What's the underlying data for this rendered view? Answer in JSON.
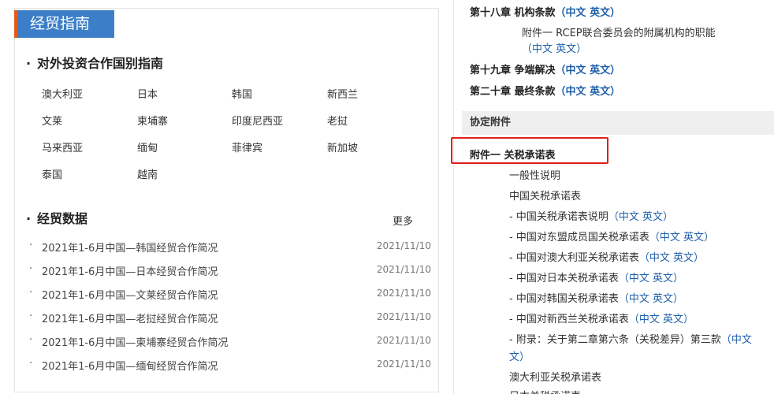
{
  "left": {
    "header": "经贸指南",
    "invest_title": "对外投资合作国别指南",
    "countries": [
      "澳大利亚",
      "日本",
      "韩国",
      "新西兰",
      "文莱",
      "柬埔寨",
      "印度尼西亚",
      "老挝",
      "马来西亚",
      "缅甸",
      "菲律宾",
      "新加坡",
      "泰国",
      "越南"
    ],
    "data_title": "经贸数据",
    "more": "更多",
    "news": [
      {
        "title": "2021年1-6月中国—韩国经贸合作简况",
        "date": "2021/11/10"
      },
      {
        "title": "2021年1-6月中国—日本经贸合作简况",
        "date": "2021/11/10"
      },
      {
        "title": "2021年1-6月中国—文莱经贸合作简况",
        "date": "2021/11/10"
      },
      {
        "title": "2021年1-6月中国—老挝经贸合作简况",
        "date": "2021/11/10"
      },
      {
        "title": "2021年1-6月中国—柬埔寨经贸合作简况",
        "date": "2021/11/10"
      },
      {
        "title": "2021年1-6月中国—缅甸经贸合作简况",
        "date": "2021/11/10"
      }
    ],
    "bullet": "·"
  },
  "right": {
    "open_paren": "（",
    "close_paren": "）",
    "zh": "中文",
    "en": "英文",
    "ch18": "第十八章 机构条款",
    "annex18": "附件一 RCEP联合委员会的附属机构的职能",
    "ch19": "第十九章 争端解决",
    "ch20": "第二十章 最终条款",
    "annex_bar": "协定附件",
    "annex1": "附件一 关税承诺表",
    "general": "一般性说明",
    "china_table": "中国关税承诺表",
    "items": [
      "- 中国关税承诺表说明",
      "- 中国对东盟成员国关税承诺表",
      "- 中国对澳大利亚关税承诺表",
      "- 中国对日本关税承诺表",
      "- 中国对韩国关税承诺表",
      "- 中国对新西兰关税承诺表"
    ],
    "appendix": "- 附录：关于第二章第六条（关税差异）第三款",
    "appendix_cont": "文",
    "aus_table": "澳大利亚关税承诺表",
    "japan_table": "日本关税承诺表"
  }
}
